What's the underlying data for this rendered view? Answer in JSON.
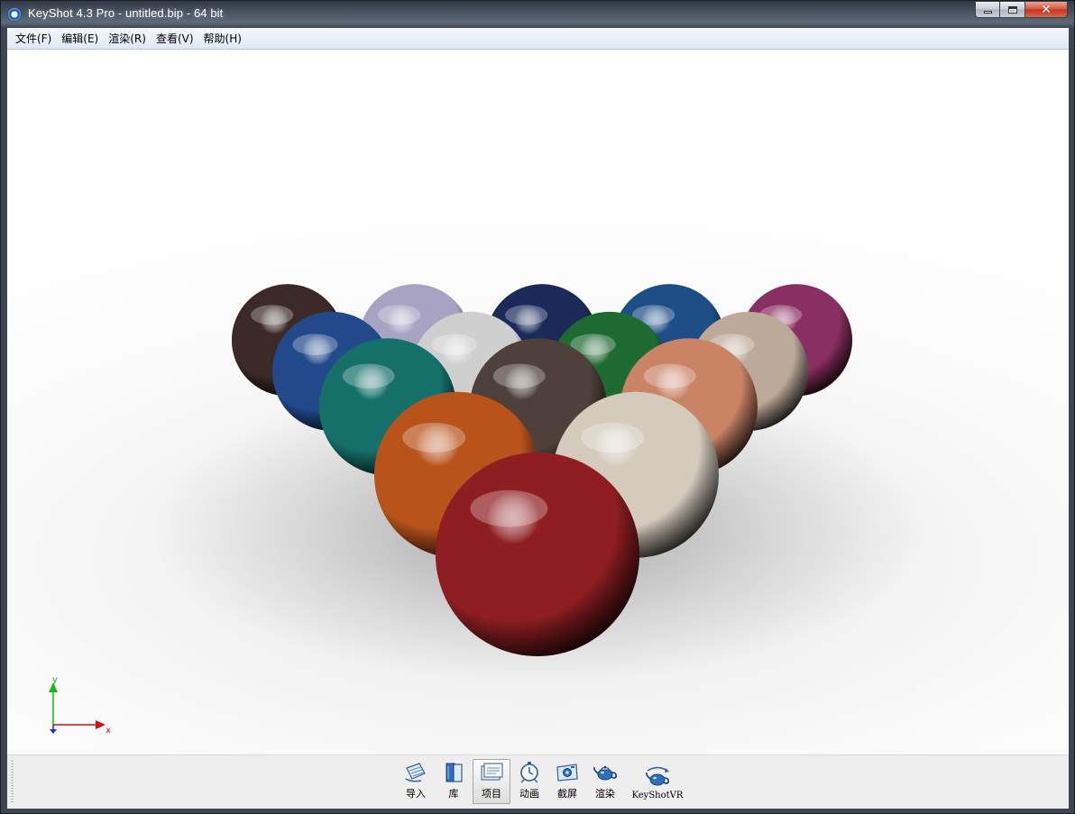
{
  "window": {
    "title": "KeyShot 4.3 Pro  - untitled.bip  - 64 bit",
    "controls": {
      "close_glyph": "✕"
    }
  },
  "menubar": {
    "items": [
      "文件(F)",
      "编辑(E)",
      "渲染(R)",
      "查看(V)",
      "帮助(H)"
    ]
  },
  "viewport": {
    "axis": {
      "x_label": "x",
      "y_label": "y",
      "x_color": "#d01212",
      "y_color": "#17b41a",
      "z_color": "#1a2fd0"
    },
    "balls": [
      {
        "row": 0,
        "color": "#3b2a27"
      },
      {
        "row": 0,
        "color": "#a9a3c3"
      },
      {
        "row": 0,
        "color": "#1c2a5a"
      },
      {
        "row": 0,
        "color": "#1d4f86"
      },
      {
        "row": 0,
        "color": "#8a2f63"
      },
      {
        "row": 1,
        "color": "#22498a"
      },
      {
        "row": 1,
        "color": "#cfcfcf"
      },
      {
        "row": 1,
        "color": "#1f6a33"
      },
      {
        "row": 1,
        "color": "#bda99a"
      },
      {
        "row": 2,
        "color": "#15706a"
      },
      {
        "row": 2,
        "color": "#4e403a"
      },
      {
        "row": 2,
        "color": "#c98466"
      },
      {
        "row": 3,
        "color": "#b8531c"
      },
      {
        "row": 3,
        "color": "#d4cbbd"
      },
      {
        "row": 4,
        "color": "#8e1e22"
      }
    ]
  },
  "toolbar": {
    "buttons": [
      {
        "label": "导入",
        "icon": "import-icon",
        "active": false
      },
      {
        "label": "库",
        "icon": "library-icon",
        "active": false
      },
      {
        "label": "项目",
        "icon": "project-icon",
        "active": true
      },
      {
        "label": "动画",
        "icon": "animation-icon",
        "active": false
      },
      {
        "label": "截屏",
        "icon": "screenshot-icon",
        "active": false
      },
      {
        "label": "渲染",
        "icon": "render-teapot-icon",
        "active": false
      },
      {
        "label": "KeyShotVR",
        "icon": "keyshotvr-icon",
        "active": false
      }
    ]
  }
}
